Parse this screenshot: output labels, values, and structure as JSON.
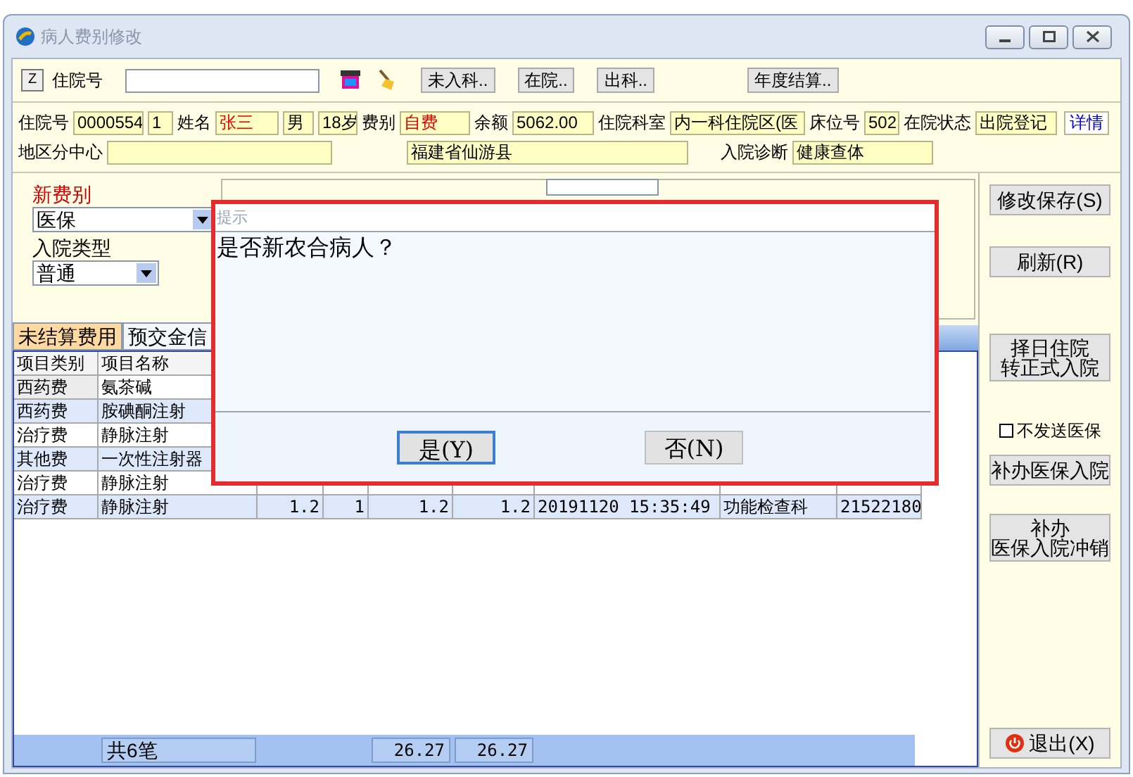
{
  "window": {
    "title": "病人费别修改"
  },
  "toolbar": {
    "z_key": "Z",
    "label": "住院号",
    "buttons": [
      "未入科..",
      "在院..",
      "出科..",
      "年度结算.."
    ]
  },
  "patient_rows": [
    [
      {
        "label": "住院号",
        "value": "0000554",
        "emphasis": false
      },
      {
        "value": "1",
        "emphasis": false
      },
      {
        "label": "姓名",
        "value": "张三",
        "emphasis": true
      },
      {
        "value": "男",
        "emphasis": false
      },
      {
        "value": "18岁",
        "emphasis": false
      },
      {
        "label": "费别",
        "value": "自费",
        "emphasis": true
      },
      {
        "label": "余额",
        "value": "5062.00",
        "emphasis": false
      },
      {
        "label": "住院科室",
        "value": "内一科住院区(医",
        "emphasis": false
      },
      {
        "label": "床位号",
        "value": "502",
        "emphasis": false
      },
      {
        "label": "在院状态",
        "value": "出院登记",
        "emphasis": false
      }
    ],
    [
      {
        "label": "地区分中心"
      },
      {
        "value": "福建省仙游县",
        "emphasis": false
      },
      {
        "label": "入院诊断",
        "value": "健康查体",
        "emphasis": false
      }
    ]
  ],
  "details_link": "详情",
  "new_fee": {
    "label": "新费别",
    "value": "医保",
    "type_label": "入院类型",
    "type_value": "普通"
  },
  "tabs": [
    {
      "label": "未结算费用",
      "selected": true
    },
    {
      "label": "预交金信",
      "selected": false
    }
  ],
  "table": {
    "columns": [
      "项目类别",
      "项目名称"
    ],
    "rows": [
      [
        "西药费",
        "氨茶碱"
      ],
      [
        "西药费",
        "胺碘酮注射"
      ],
      [
        "治疗费",
        "静脉注射"
      ],
      [
        "其他费",
        "一次性注射器"
      ],
      [
        "治疗费",
        "静脉注射"
      ],
      [
        "治疗费",
        "静脉注射",
        "1.2",
        "1",
        "1.2",
        "1.2",
        "20191120 15:35:49",
        "功能检查科",
        "21522180"
      ]
    ],
    "footer": [
      "共6笔",
      "26.27",
      "26.27"
    ]
  },
  "side_buttons": [
    {
      "kind": "button",
      "lines": [
        "修改保存(S)"
      ]
    },
    {
      "kind": "button",
      "lines": [
        "刷新(R)"
      ]
    },
    {
      "kind": "button",
      "lines": [
        "择日住院",
        "转正式入院"
      ]
    },
    {
      "kind": "checkbox",
      "label": "不发送医保",
      "checked": false
    },
    {
      "kind": "button",
      "lines": [
        "补办医保入院"
      ]
    },
    {
      "kind": "button",
      "lines": [
        "补办",
        "医保入院冲销"
      ]
    }
  ],
  "exit_button": "退出(X)",
  "dialog": {
    "title": "提示",
    "message": "是否新农合病人？",
    "buttons": [
      {
        "label": "是(Y)",
        "selected": true
      },
      {
        "label": "否(N)",
        "selected": false
      }
    ]
  }
}
